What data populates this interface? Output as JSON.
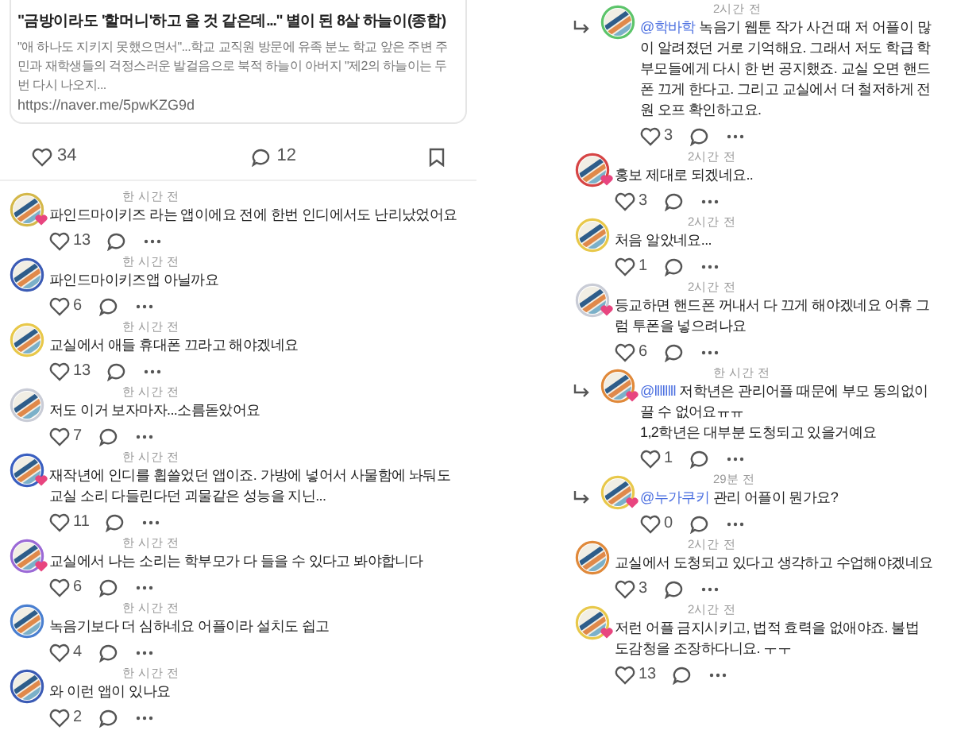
{
  "post": {
    "title": "\"금방이라도 '할머니'하고 올 것 같은데...\" 별이 된 8살 하늘이(종합)",
    "excerpt": "\"애 하나도 지키지 못했으면서\"...학교 교직원 방문에 유족 분노 학교 앞은 주변 주민과 재학생들의 걱정스러운 발걸음으로 북적 하늘이 아버지 \"제2의 하늘이는 두 번 다시 나오지...",
    "url": "https://naver.me/5pwKZG9d",
    "likes": "34",
    "comments": "12"
  },
  "left_comments": [
    {
      "time": "한 시간 전",
      "text": "파인드마이키즈 라는 앱이에요 전에 한번 인디에서도 난리났었어요",
      "likes": "13",
      "reply": false,
      "heart_badge": true,
      "color": "#d4b84a"
    },
    {
      "time": "한 시간 전",
      "text": "파인드마이키즈앱 아닐까요",
      "likes": "6",
      "reply": false,
      "heart_badge": false,
      "color": "#3b5bb5"
    },
    {
      "time": "한 시간 전",
      "text": "교실에서 애들 휴대폰 끄라고 해야겠네요",
      "likes": "13",
      "reply": false,
      "heart_badge": false,
      "color": "#e8c84a"
    },
    {
      "time": "한 시간 전",
      "text": "저도 이거 보자마자...소름돋았어요",
      "likes": "7",
      "reply": false,
      "heart_badge": false,
      "color": "#c9ccd6"
    },
    {
      "time": "한 시간 전",
      "text": "재작년에 인디를 휩쓸었던 앱이죠. 가방에 넣어서 사물함에 놔둬도 교실 소리 다들린다던 괴물같은 성능을 지닌...",
      "likes": "11",
      "reply": false,
      "heart_badge": true,
      "color": "#3a5fc0"
    },
    {
      "time": "한 시간 전",
      "text": "교실에서 나는 소리는 학부모가 다 들을 수 있다고 봐야합니다",
      "likes": "6",
      "reply": false,
      "heart_badge": true,
      "color": "#9b6ad6"
    },
    {
      "time": "한 시간 전",
      "text": "녹음기보다 더 심하네요 어플이라 설치도 쉽고",
      "likes": "4",
      "reply": false,
      "heart_badge": false,
      "color": "#4a7fd0"
    },
    {
      "time": "한 시간 전",
      "text": "와 이런 앱이 있나요",
      "likes": "2",
      "reply": false,
      "heart_badge": false,
      "color": "#3b5bb5"
    }
  ],
  "right_comments": [
    {
      "time": "2시간 전",
      "mention": "@학바학",
      "text": "녹음기 웹툰 작가 사건 때 저 어플이 많이 알려졌던 거로 기억해요. 그래서 저도 학급 학부모들에게 다시 한 번 공지했죠. 교실 오면 핸드폰 끄게 한다고. 그리고 교실에서 더 철저하게 전원 오프 확인하고요.",
      "likes": "3",
      "reply": true,
      "heart_badge": false,
      "color": "#5cc46a"
    },
    {
      "time": "2시간 전",
      "text": "홍보 제대로 되겠네요..",
      "likes": "3",
      "reply": false,
      "heart_badge": true,
      "color": "#d64545"
    },
    {
      "time": "2시간 전",
      "text": "처음 알았네요...",
      "likes": "1",
      "reply": false,
      "heart_badge": false,
      "color": "#e8c84a"
    },
    {
      "time": "2시간 전",
      "text": "등교하면 핸드폰 꺼내서 다 끄게 해야겠네요 어휴 그럼 투폰을 넣으려나요",
      "likes": "6",
      "reply": false,
      "heart_badge": true,
      "color": "#c9ccd6"
    },
    {
      "time": "한 시간 전",
      "mention": "@llllllll",
      "text": "저학년은 관리어플 때문에 부모 동의없이 끌 수 없어요ㅠㅠ\n1,2학년은 대부분 도청되고 있을거예요",
      "likes": "1",
      "reply": true,
      "heart_badge": true,
      "color": "#e0893a"
    },
    {
      "time": "29분 전",
      "mention": "@누가쿠키",
      "text": "관리 어플이 뭔가요?",
      "likes": "0",
      "reply": true,
      "heart_badge": true,
      "color": "#e8c84a"
    },
    {
      "time": "2시간 전",
      "text": "교실에서 도청되고 있다고 생각하고 수업해야겠네요",
      "likes": "3",
      "reply": false,
      "heart_badge": false,
      "color": "#e0893a"
    },
    {
      "time": "2시간 전",
      "text": "저런 어플 금지시키고, 법적 효력을 없애야죠. 불법 도감청을 조장하다니요. ㅜㅜ",
      "likes": "13",
      "reply": false,
      "heart_badge": true,
      "color": "#e8c84a"
    }
  ]
}
